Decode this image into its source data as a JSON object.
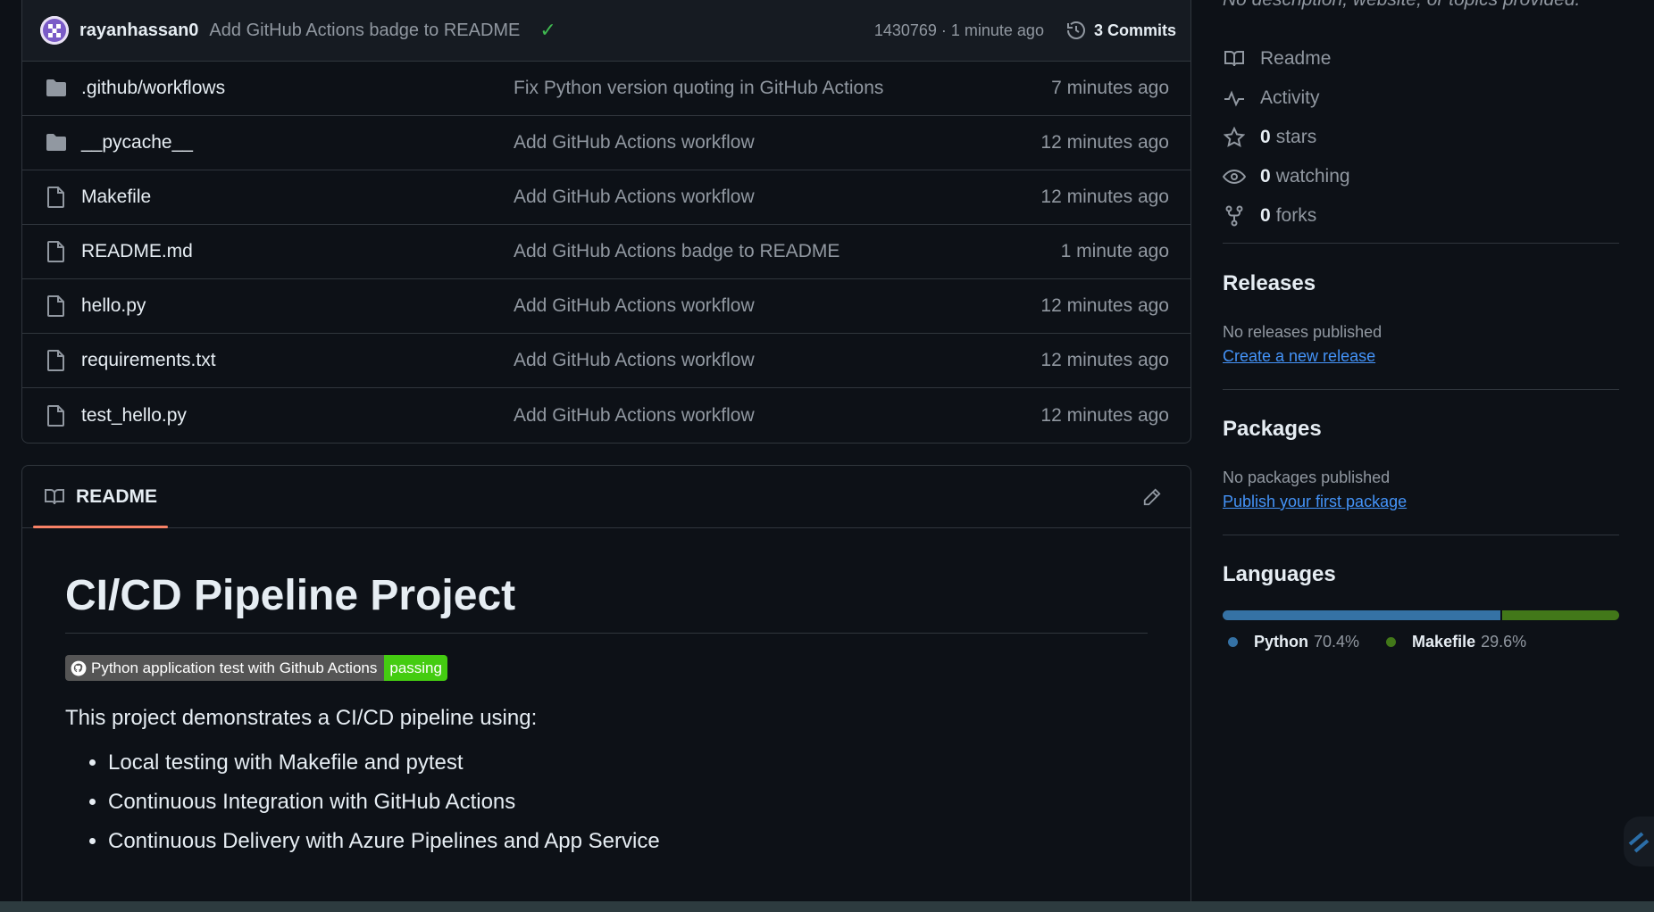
{
  "commit": {
    "author": "rayanhassan0",
    "message": "Add GitHub Actions badge to README",
    "meta": "1430769 · 1 minute ago",
    "commits_label": "3 Commits"
  },
  "files": [
    {
      "name": ".github/workflows",
      "type": "folder",
      "commit": "Fix Python version quoting in GitHub Actions",
      "time": "7 minutes ago"
    },
    {
      "name": "__pycache__",
      "type": "folder",
      "commit": "Add GitHub Actions workflow",
      "time": "12 minutes ago"
    },
    {
      "name": "Makefile",
      "type": "file",
      "commit": "Add GitHub Actions workflow",
      "time": "12 minutes ago"
    },
    {
      "name": "README.md",
      "type": "file",
      "commit": "Add GitHub Actions badge to README",
      "time": "1 minute ago"
    },
    {
      "name": "hello.py",
      "type": "file",
      "commit": "Add GitHub Actions workflow",
      "time": "12 minutes ago"
    },
    {
      "name": "requirements.txt",
      "type": "file",
      "commit": "Add GitHub Actions workflow",
      "time": "12 minutes ago"
    },
    {
      "name": "test_hello.py",
      "type": "file",
      "commit": "Add GitHub Actions workflow",
      "time": "12 minutes ago"
    }
  ],
  "readme": {
    "tab_label": "README",
    "title": "CI/CD Pipeline Project",
    "badge_label": "Python application test with Github Actions",
    "badge_status": "passing",
    "intro": "This project demonstrates a CI/CD pipeline using:",
    "bullets": [
      "Local testing with Makefile and pytest",
      "Continuous Integration with GitHub Actions",
      "Continuous Delivery with Azure Pipelines and App Service"
    ]
  },
  "about": {
    "description": "No description, website, or topics provided.",
    "readme_label": "Readme",
    "activity_label": "Activity",
    "stars_count": "0",
    "stars_label": "stars",
    "watching_count": "0",
    "watching_label": "watching",
    "forks_count": "0",
    "forks_label": "forks"
  },
  "releases": {
    "heading": "Releases",
    "status": "No releases published",
    "link": "Create a new release"
  },
  "packages": {
    "heading": "Packages",
    "status": "No packages published",
    "link": "Publish your first package"
  },
  "languages": {
    "heading": "Languages",
    "items": [
      {
        "name": "Python",
        "percent": "70.4%",
        "value": 70.4,
        "color": "#3572A5"
      },
      {
        "name": "Makefile",
        "percent": "29.6%",
        "value": 29.6,
        "color": "#427819"
      }
    ]
  },
  "colors": {
    "accent_link": "#4493f8",
    "success": "#3fb950",
    "tab_underline": "#f78166"
  }
}
